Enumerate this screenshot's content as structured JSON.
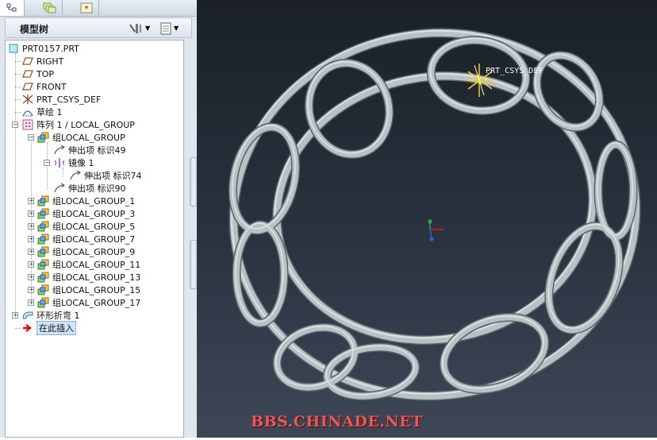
{
  "tabs": [
    {
      "icon": "model-tree-tab-icon"
    },
    {
      "icon": "layers-tab-icon"
    },
    {
      "icon": "favorites-tab-icon"
    }
  ],
  "panel": {
    "title": "模型树",
    "settings_icon": "tools-icon",
    "show_icon": "list-icon"
  },
  "tree": {
    "root": "PRT0157.PRT",
    "items": [
      {
        "label": "RIGHT"
      },
      {
        "label": "TOP"
      },
      {
        "label": "FRONT"
      },
      {
        "label": "PRT_CSYS_DEF"
      },
      {
        "label": "草绘 1"
      },
      {
        "label": "阵列 1 / LOCAL_GROUP"
      },
      {
        "label": "组LOCAL_GROUP"
      },
      {
        "label": "伸出项 标识49"
      },
      {
        "label": "镜像 1"
      },
      {
        "label": "伸出项 标识74"
      },
      {
        "label": "伸出项 标识90"
      },
      {
        "label": "组LOCAL_GROUP_1"
      },
      {
        "label": "组LOCAL_GROUP_3"
      },
      {
        "label": "组LOCAL_GROUP_5"
      },
      {
        "label": "组LOCAL_GROUP_7"
      },
      {
        "label": "组LOCAL_GROUP_9"
      },
      {
        "label": "组LOCAL_GROUP_11"
      },
      {
        "label": "组LOCAL_GROUP_13"
      },
      {
        "label": "组LOCAL_GROUP_15"
      },
      {
        "label": "组LOCAL_GROUP_17"
      },
      {
        "label": "环形折弯 1"
      },
      {
        "label": "在此插入"
      }
    ]
  },
  "viewport": {
    "csys_label": "PRT_CSYS_DEF",
    "watermark": "BBS.CHINADE.NET",
    "model_color": "#b9c0c6",
    "background_top": "#1b2028",
    "background_bottom": "#3d4756"
  }
}
